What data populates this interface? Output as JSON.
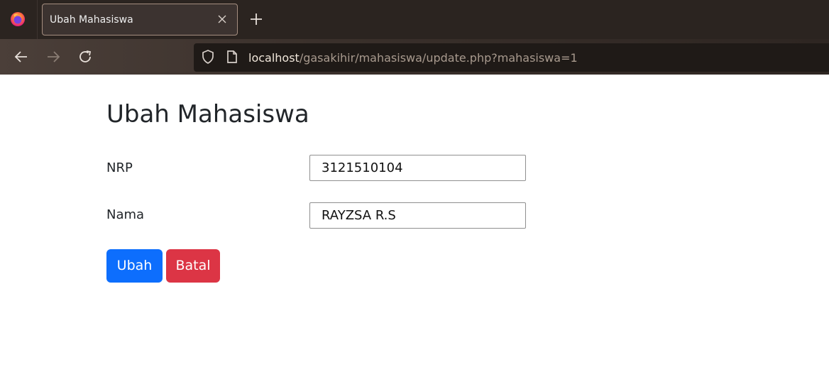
{
  "browser": {
    "tab": {
      "title": "Ubah Mahasiswa"
    },
    "url": {
      "host": "localhost",
      "path": "/gasakihir/mahasiswa/update.php?mahasiswa=1"
    },
    "icons": [
      "firefox-icon",
      "close-icon",
      "plus-icon",
      "back-icon",
      "forward-icon",
      "reload-icon",
      "shield-icon",
      "page-icon"
    ]
  },
  "form": {
    "title": "Ubah Mahasiswa",
    "nrp_label": "NRP",
    "nrp_value": "3121510104",
    "nama_label": "Nama",
    "nama_value": "RAYZSA R.S",
    "submit_label": "Ubah",
    "cancel_label": "Batal"
  },
  "colors": {
    "primary": "#0d6efd",
    "danger": "#dc3545",
    "tab_bar": "#2b2420"
  }
}
